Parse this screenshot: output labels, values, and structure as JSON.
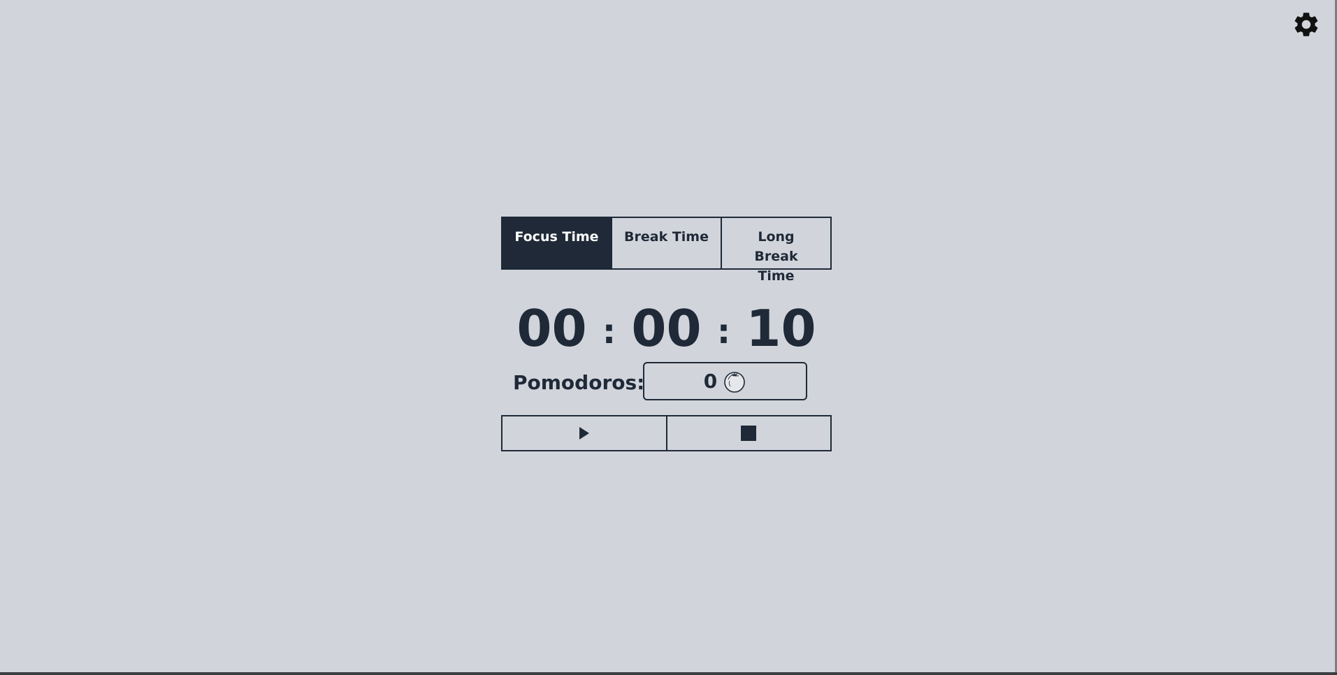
{
  "header": {
    "settings_icon": "gear-icon"
  },
  "tabs": [
    {
      "label": "Focus Time",
      "active": true
    },
    {
      "label": "Break Time",
      "active": false
    },
    {
      "label": "Long Break Time",
      "active": false
    }
  ],
  "timer": {
    "hours": "00",
    "minutes": "00",
    "seconds": "10",
    "separator": ":"
  },
  "pomodoros": {
    "label": "Pomodoros:",
    "count": "0",
    "icon": "tomato-icon"
  },
  "controls": {
    "play_icon": "play-icon",
    "stop_icon": "stop-icon"
  },
  "colors": {
    "background": "#d1d5db",
    "primary": "#1f2937",
    "active_text": "#ffffff"
  }
}
